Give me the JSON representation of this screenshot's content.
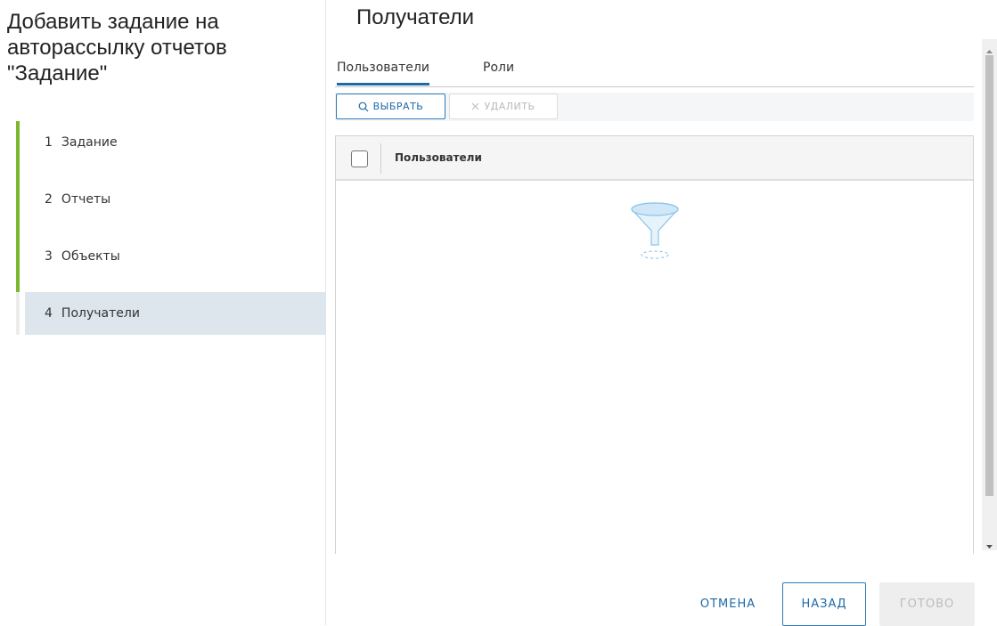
{
  "wizard": {
    "title": "Добавить задание на авторассылку отчетов \"Задание\"",
    "steps": [
      {
        "num": "1",
        "label": "Задание"
      },
      {
        "num": "2",
        "label": "Отчеты"
      },
      {
        "num": "3",
        "label": "Объекты"
      },
      {
        "num": "4",
        "label": "Получатели"
      }
    ]
  },
  "main": {
    "heading": "Получатели",
    "tabs": [
      "Пользователи",
      "Роли"
    ],
    "toolbar": {
      "select_label": "ВЫБРАТЬ",
      "delete_label": "УДАЛИТЬ"
    },
    "grid": {
      "column_header": "Пользователи"
    }
  },
  "footer": {
    "cancel_label": "ОТМЕНА",
    "back_label": "НАЗАД",
    "done_label": "ГОТОВО"
  },
  "icons": {
    "select": "search-icon",
    "delete": "close-icon",
    "empty": "filter-funnel-icon"
  },
  "colors": {
    "accent": "#1e6aa8",
    "step_done": "#7cb82f",
    "active_step_bg": "#dce6ec"
  }
}
